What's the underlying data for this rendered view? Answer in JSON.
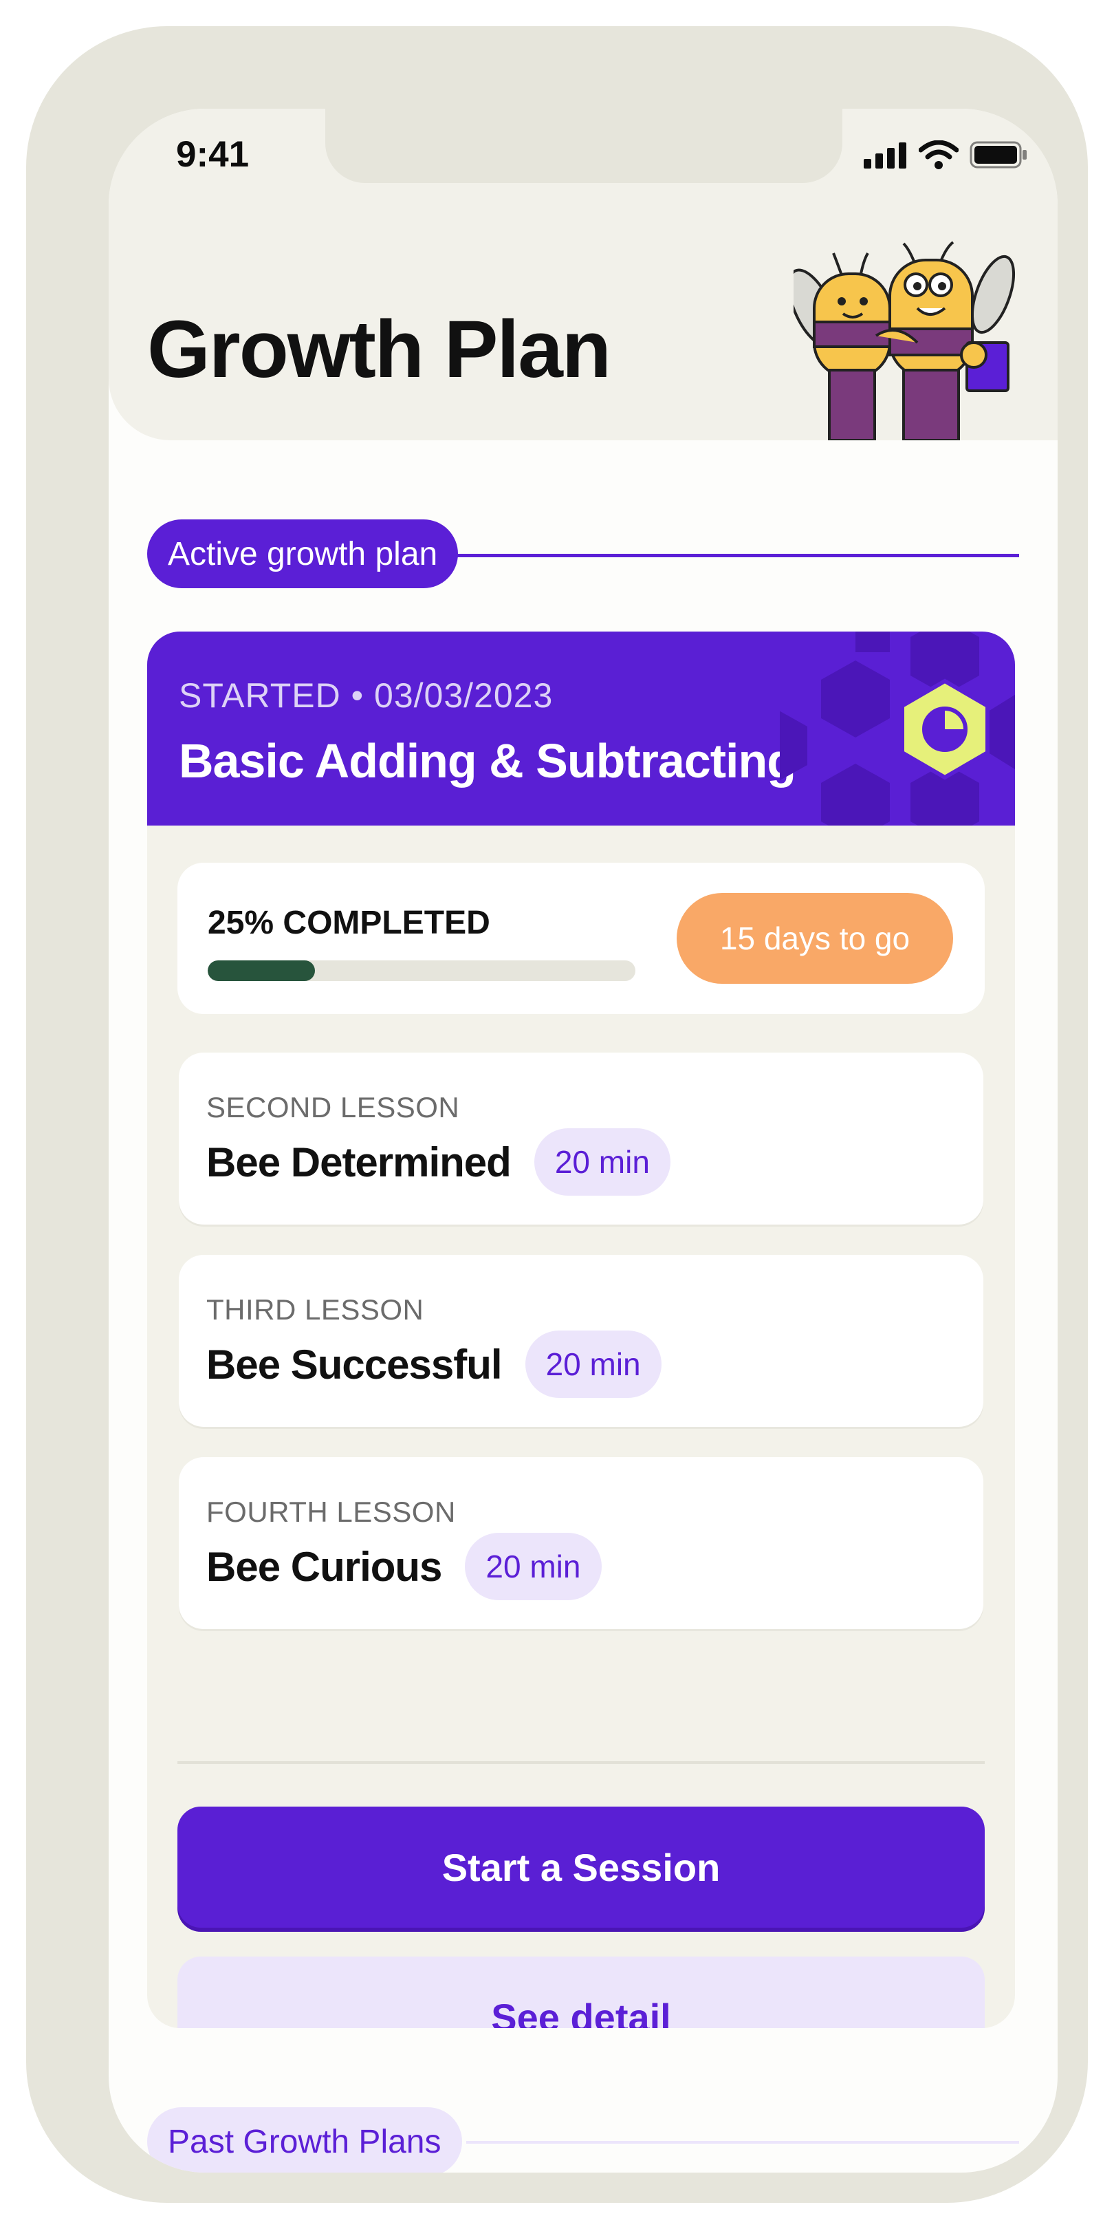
{
  "status_bar": {
    "time": "9:41"
  },
  "header": {
    "title": "Growth Plan"
  },
  "active_section": {
    "label": "Active growth plan"
  },
  "plan": {
    "started": "STARTED • 03/03/2023",
    "name": "Basic Adding & Subtracting",
    "progress_label": "25% COMPLETED",
    "progress_fraction": 0.25,
    "days_left": "15 days to go"
  },
  "lessons": [
    {
      "tag": "SECOND LESSON",
      "name": "Bee Determined",
      "duration": "20 min"
    },
    {
      "tag": "THIRD LESSON",
      "name": "Bee Successful",
      "duration": "20 min"
    },
    {
      "tag": "FOURTH LESSON",
      "name": "Bee Curious",
      "duration": "20 min"
    }
  ],
  "actions": {
    "start_label": "Start a Session",
    "detail_label": "See detail"
  },
  "past_section": {
    "label": "Past Growth Plans"
  },
  "colors": {
    "primary": "#5a1fd4",
    "accent_orange": "#f9a867",
    "progress_fill": "#27543c",
    "light_purple": "#ece5fb",
    "hex_icon": "#e6f07a"
  },
  "icons": [
    "signal-icon",
    "wifi-icon",
    "battery-icon",
    "pie-chart-icon",
    "bee-illustration"
  ]
}
